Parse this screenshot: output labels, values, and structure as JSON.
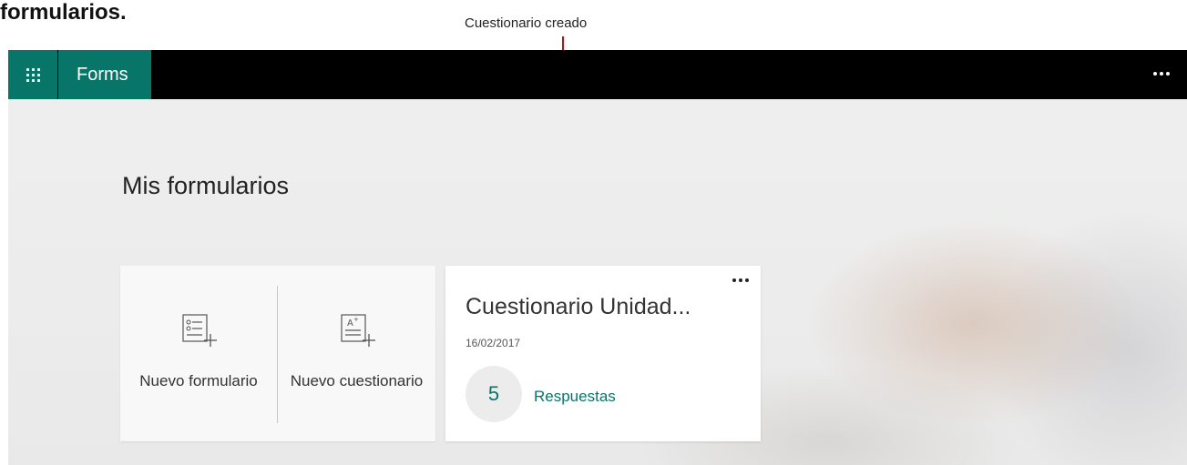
{
  "document": {
    "heading_fragment": "formularios.",
    "callout_label": "Cuestionario creado"
  },
  "topbar": {
    "app_name": "Forms",
    "icons": {
      "launcher": "app-launcher-icon",
      "more": "more-options-icon"
    }
  },
  "main": {
    "page_title": "Mis formularios",
    "new_actions": [
      {
        "label": "Nuevo formulario",
        "icon": "new-form-icon"
      },
      {
        "label": "Nuevo cuestionario",
        "icon": "new-quiz-icon"
      }
    ],
    "forms": [
      {
        "title": "Cuestionario Unidad...",
        "date": "16/02/2017",
        "responses_count": "5",
        "responses_label": "Respuestas"
      }
    ]
  },
  "colors": {
    "brand": "#077568",
    "topbar": "#000000",
    "callout": "#e0000c"
  }
}
